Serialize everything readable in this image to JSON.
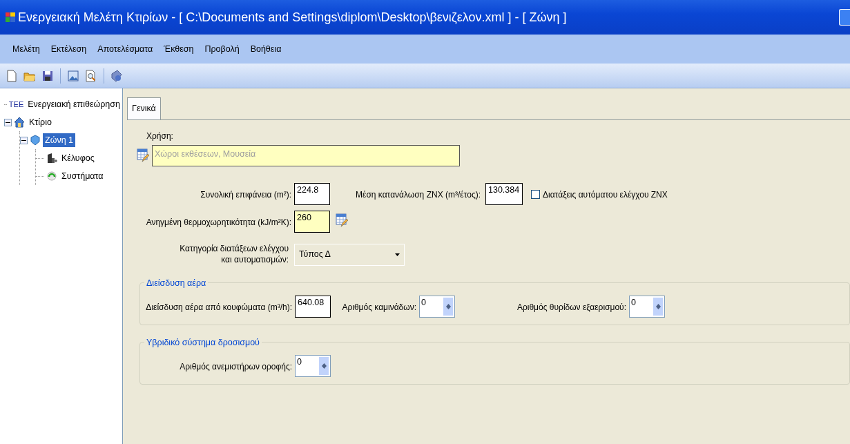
{
  "window": {
    "title": "Ενεργειακή Μελέτη Κτιρίων - [ C:\\Documents and Settings\\diplom\\Desktop\\βενιζελον.xml ] - [ Ζώνη ]"
  },
  "menu": [
    "Μελέτη",
    "Εκτέλεση",
    "Αποτελέσματα",
    "Έκθεση",
    "Προβολή",
    "Βοήθεια"
  ],
  "tree": [
    {
      "label": "Ενεργειακή επιθεώρηση",
      "kind": "inspection",
      "badge": "ΤΕΕ",
      "selected": false
    },
    {
      "label": "Κτίριο",
      "kind": "building",
      "selected": false,
      "expanded": true,
      "children": [
        {
          "label": "Ζώνη 1",
          "kind": "zone",
          "selected": true,
          "expanded": true,
          "children": [
            {
              "label": "Κέλυφος",
              "kind": "envelope",
              "selected": false
            },
            {
              "label": "Συστήματα",
              "kind": "systems",
              "selected": false
            }
          ]
        }
      ]
    }
  ],
  "tabs": [
    {
      "label": "Γενικά",
      "selected": true
    }
  ],
  "usage": {
    "label": "Χρήση:",
    "value": "Χώροι εκθέσεων, Μουσεία"
  },
  "total_area": {
    "label": "Συνολική επιφάνεια (m²):",
    "value": "224.8",
    "highlighted": false
  },
  "dhw_consumption": {
    "label": "Μέση κατανάλωση ΖΝΧ (m³/έτος):",
    "value": "130.384",
    "highlighted": false
  },
  "auto_controls": {
    "label": "Διατάξεις αυτόματου ελέγχου ΖΝΧ",
    "checked": false
  },
  "heat_capacity": {
    "label": "Ανηγμένη θερμοχωρητικότητα (kJ/m²K):",
    "value": "260",
    "highlighted": true
  },
  "control_category": {
    "label": "Κατηγορία διατάξεων ελέγχου\nκαι αυτοματισμών:",
    "value": "Τύπος Δ"
  },
  "groups": [
    {
      "title": "Διείσδυση αέρα",
      "fields": [
        {
          "kind": "text",
          "label": "Διείσδυση αέρα από κουφώματα (m³/h):",
          "value": "640.08"
        },
        {
          "kind": "spin",
          "label": "Αριθμός καμινάδων:",
          "value": "0"
        },
        {
          "kind": "spin",
          "label": "Αριθμός θυρίδων εξαερισμού:",
          "value": "0"
        }
      ]
    },
    {
      "title": "Υβριδικό σύστημα δροσισμού",
      "fields": [
        {
          "kind": "spin",
          "label": "Αριθμός ανεμιστήρων οροφής:",
          "value": "0"
        }
      ]
    }
  ]
}
